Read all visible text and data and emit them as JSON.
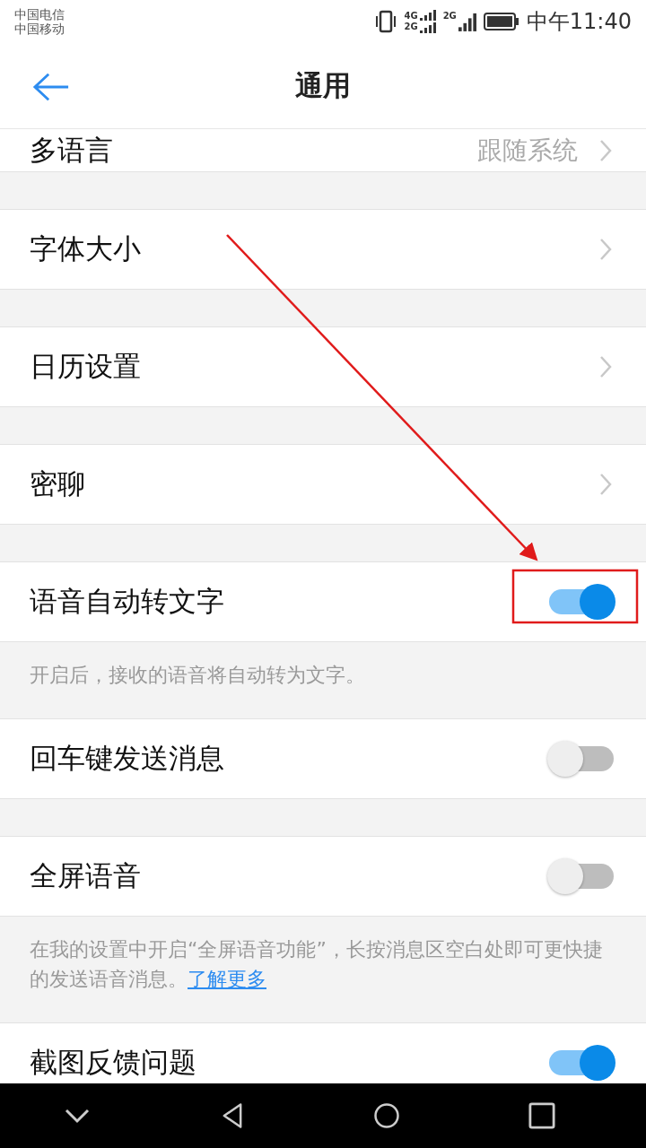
{
  "status_bar": {
    "carriers": [
      "中国电信",
      "中国移动"
    ],
    "network_labels": [
      "4G",
      "2G",
      "2G"
    ],
    "time": "中午11:40"
  },
  "header": {
    "title": "通用"
  },
  "sections": [
    {
      "items": [
        {
          "kind": "link",
          "label": "多语言",
          "value": "跟随系统"
        }
      ]
    },
    {
      "items": [
        {
          "kind": "link",
          "label": "字体大小"
        }
      ]
    },
    {
      "items": [
        {
          "kind": "link",
          "label": "日历设置"
        }
      ]
    },
    {
      "items": [
        {
          "kind": "link",
          "label": "密聊"
        }
      ]
    },
    {
      "items": [
        {
          "kind": "switch",
          "label": "语音自动转文字",
          "on": true
        }
      ],
      "note": "开启后，接收的语音将自动转为文字。"
    },
    {
      "items": [
        {
          "kind": "switch",
          "label": "回车键发送消息",
          "on": false
        }
      ]
    },
    {
      "items": [
        {
          "kind": "switch",
          "label": "全屏语音",
          "on": false
        }
      ],
      "note": "在我的设置中开启“全屏语音功能”，长按消息区空白处即可更快捷的发送语音消息。",
      "note_link": "了解更多"
    },
    {
      "items": [
        {
          "kind": "switch",
          "label": "截图反馈问题",
          "on": true
        }
      ]
    }
  ]
}
